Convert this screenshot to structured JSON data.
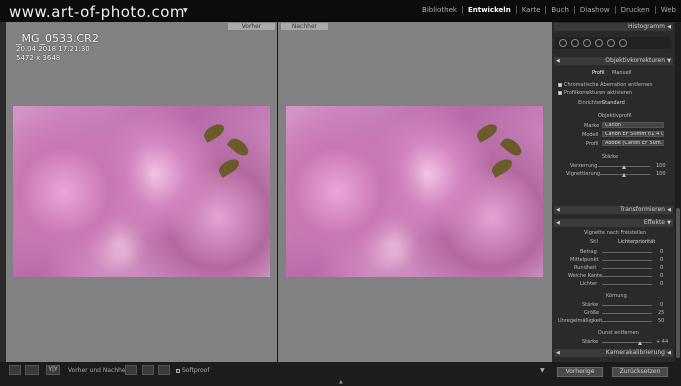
{
  "logo": "www.art-of-photo.com",
  "modules": [
    "Bibliothek",
    "Entwickeln",
    "Karte",
    "Buch",
    "Diashow",
    "Drucken",
    "Web"
  ],
  "active_module": "Entwickeln",
  "panes": {
    "before": "Vorher",
    "after": "Nachher"
  },
  "file": {
    "name": "_MG_0533.CR2",
    "date": "20.04.2018 17:21:30",
    "dims": "5472 x 3648"
  },
  "histogram": "Histogramm",
  "lens": {
    "title": "Objektivkorrekturen",
    "tabs": [
      "Profil",
      "Manuell"
    ],
    "ca": "Chromatische Aberration entfernen",
    "profile_on": "Profilkorrekturen aktivieren",
    "setup_label": "Einrichten",
    "setup_value": "Standard",
    "profile_section": "Objektivprofil",
    "marke_label": "Marke",
    "marke_value": "Canon",
    "modell_label": "Modell",
    "modell_value": "Canon EF 50mm f/1.4 U...",
    "profil_label": "Profil",
    "profil_value": "Adobe (Canon EF 50m...",
    "staerke": "Stärke",
    "verzerrung_label": "Verzerrung",
    "verzerrung_value": "100",
    "vignet_label": "Vignettierung",
    "vignet_value": "100"
  },
  "transform": "Transformieren",
  "effects": {
    "title": "Effekte",
    "vig_title": "Vignette nach Freistellen",
    "stil_label": "Stil",
    "stil_value": "Lichterpriorität",
    "betrag": "Betrag",
    "mittelpunkt": "Mittelpunkt",
    "rundheit": "Rundheit",
    "weiche": "Weiche Kante",
    "lichter": "Lichter",
    "vals": [
      "0",
      "0",
      "0",
      "0",
      "0"
    ],
    "koernung": "Körnung",
    "staerke": "Stärke",
    "groesse": "Größe",
    "unregel": "Unregelmäßigkeit",
    "k_vals": [
      "0",
      "25",
      "50"
    ],
    "dunst": "Dunst entfernen",
    "d_staerke": "Stärke",
    "d_val": "+ 44"
  },
  "kamera": "Kamerakalibrierung",
  "bottom": {
    "vn": "Vorher und Nachher:",
    "softproof": "Softproof",
    "prev": "Vorherige",
    "reset": "Zurücksetzen",
    "yy": "Y|Y"
  }
}
